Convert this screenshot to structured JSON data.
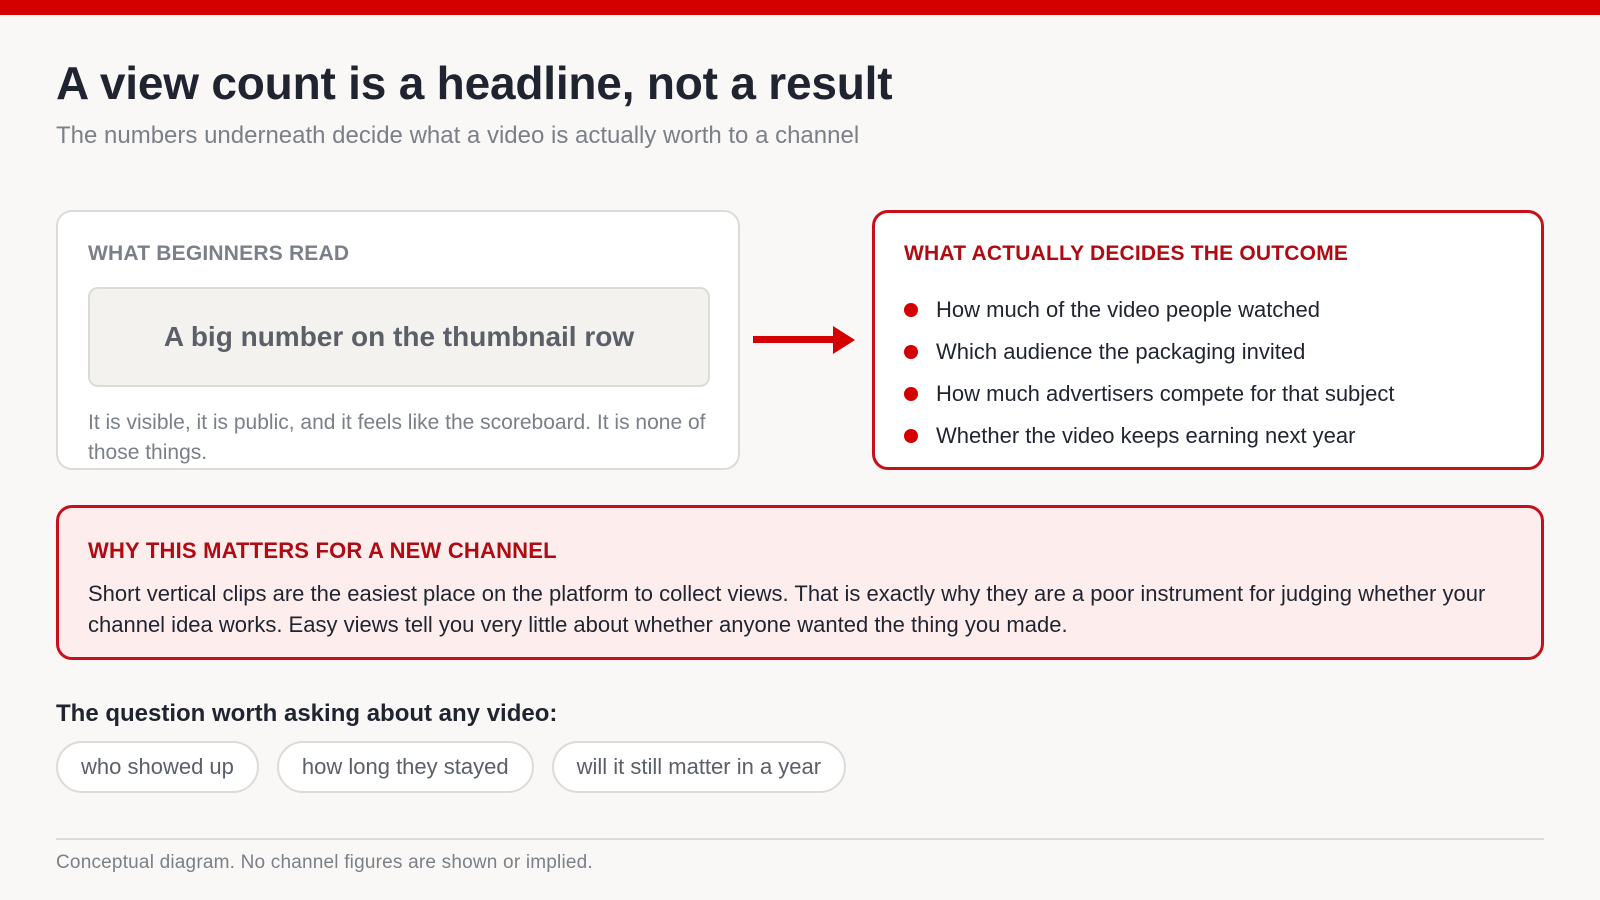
{
  "title": "A view count is a headline, not a result",
  "subtitle": "The numbers underneath decide what a video is actually worth to a channel",
  "left_card": {
    "heading": "WHAT BEGINNERS READ",
    "box_text": "A big number on the thumbnail row",
    "note": "It is visible, it is public, and it feels like the scoreboard. It is none of those things."
  },
  "right_card": {
    "heading": "WHAT ACTUALLY DECIDES THE OUTCOME",
    "items": [
      "How much of the video people watched",
      "Which audience the packaging invited",
      "How much advertisers compete for that subject",
      "Whether the video keeps earning next year"
    ]
  },
  "why": {
    "heading": "WHY THIS MATTERS FOR A NEW CHANNEL",
    "text": "Short vertical clips are the easiest place on the platform to collect views. That is exactly why they are a poor instrument for judging whether your channel idea works. Easy views tell you very little about whether anyone wanted the thing you made."
  },
  "question": {
    "label": "The question worth asking about any video:",
    "chips": [
      "who showed up",
      "how long they stayed",
      "will it still matter in a year"
    ]
  },
  "footnote": "Conceptual diagram. No channel figures are shown or implied.",
  "colors": {
    "accent": "#d40000",
    "accent_dark": "#b00a12",
    "why_background": "#fdeeed",
    "page_background": "#f9f8f6"
  },
  "icons": {
    "arrow": "arrow-right-icon",
    "bullet": "bullet-dot-icon"
  }
}
